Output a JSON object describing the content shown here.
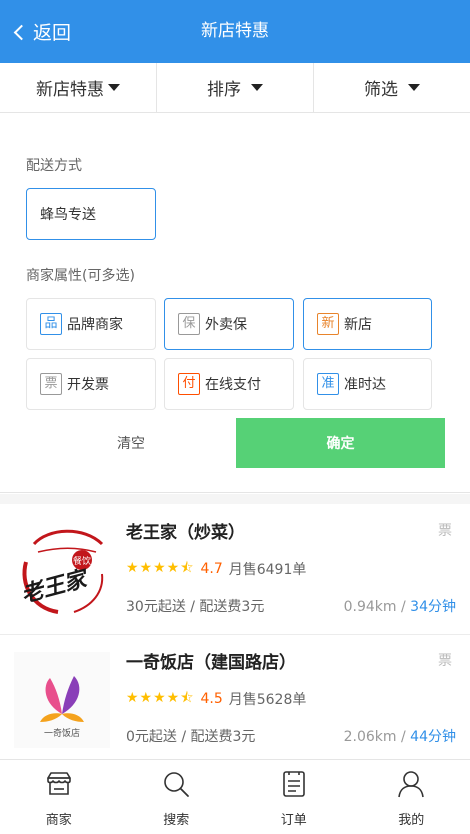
{
  "header": {
    "back_label": "返回",
    "title": "新店特惠"
  },
  "filters": [
    {
      "label": "新店特惠"
    },
    {
      "label": "排序"
    },
    {
      "label": "筛选"
    }
  ],
  "panel": {
    "delivery_title": "配送方式",
    "delivery_option": "蜂鸟专送",
    "attrs_title": "商家属性(可多选)",
    "attrs": [
      {
        "badge": "品",
        "label": "品牌商家",
        "color": "#3190e8"
      },
      {
        "badge": "保",
        "label": "外卖保",
        "color": "#999999"
      },
      {
        "badge": "新",
        "label": "新店",
        "color": "#e8842b"
      },
      {
        "badge": "票",
        "label": "开发票",
        "color": "#999999"
      },
      {
        "badge": "付",
        "label": "在线支付",
        "color": "#ff4e00"
      },
      {
        "badge": "准",
        "label": "准时达",
        "color": "#3190e8"
      }
    ],
    "clear_label": "清空",
    "confirm_label": "确定"
  },
  "shops": [
    {
      "name": "老王家（炒菜）",
      "ticket": "票",
      "score": "4.7",
      "sales": "月售6491单",
      "fee": "30元起送 / 配送费3元",
      "distance": "0.94km / ",
      "time": "34分钟",
      "logo_text": "老王家",
      "logo_badge": "餐饮"
    },
    {
      "name": "一奇饭店（建国路店）",
      "ticket": "票",
      "score": "4.5",
      "sales": "月售5628单",
      "fee": "0元起送 / 配送费3元",
      "distance": "2.06km / ",
      "time": "44分钟",
      "logo_text": "一奇饭店"
    }
  ],
  "tabbar": [
    {
      "label": "商家",
      "icon": "shop-icon"
    },
    {
      "label": "搜索",
      "icon": "search-icon"
    },
    {
      "label": "订单",
      "icon": "order-icon"
    },
    {
      "label": "我的",
      "icon": "user-icon"
    }
  ],
  "colors": {
    "brand": "#3190e8",
    "confirm": "#56d176",
    "score": "#ff6000",
    "star": "#ffbe00"
  }
}
